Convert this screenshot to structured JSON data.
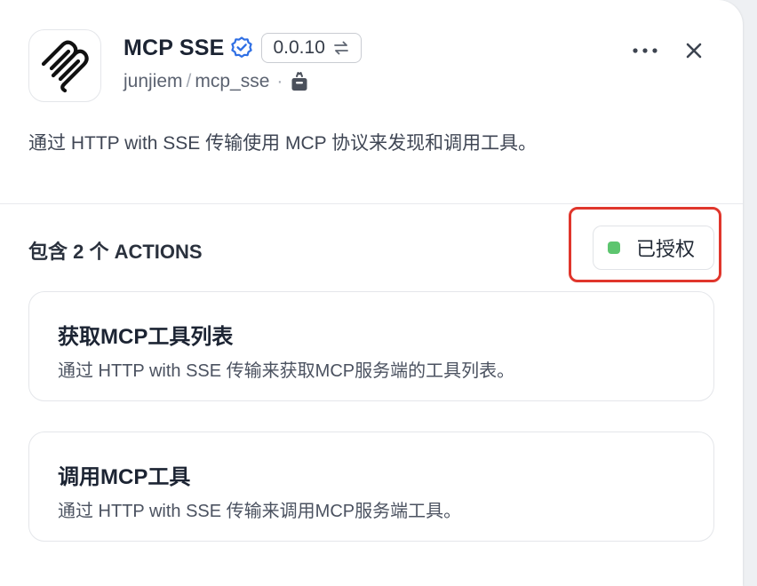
{
  "plugin": {
    "name": "MCP SSE",
    "version": "0.0.10",
    "author": "junjiem",
    "repo": "mcp_sse",
    "description": "通过 HTTP with SSE 传输使用 MCP 协议来发现和调用工具。",
    "icons": {
      "logo": "spring-coil-logo",
      "verified": "verified-badge-icon",
      "switch_version": "switch-arrows-icon",
      "plugin_type": "package-icon",
      "more": "more-dots-icon",
      "close": "close-icon"
    }
  },
  "actions_section": {
    "title": "包含 2 个 ACTIONS",
    "auth_status": "已授权",
    "auth_status_color": "#5dc56f",
    "highlight_color": "#e0362c"
  },
  "actions": [
    {
      "title": "获取MCP工具列表",
      "description": "通过 HTTP with SSE 传输来获取MCP服务端的工具列表。"
    },
    {
      "title": "调用MCP工具",
      "description": "通过 HTTP with SSE 传输来调用MCP服务端工具。"
    }
  ]
}
